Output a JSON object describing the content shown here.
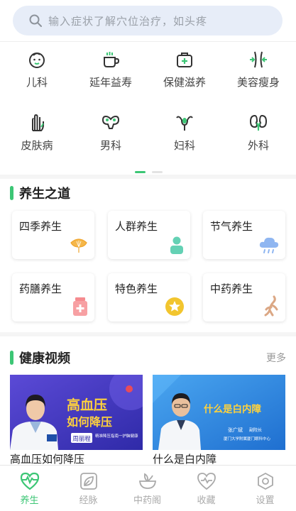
{
  "search": {
    "placeholder": "输入症状了解穴位治疗，如头疼"
  },
  "categories": [
    {
      "label": "儿科",
      "icon": "child-face-icon"
    },
    {
      "label": "延年益寿",
      "icon": "teacup-icon"
    },
    {
      "label": "保健滋养",
      "icon": "first-aid-kit-icon"
    },
    {
      "label": "美容瘦身",
      "icon": "waist-slim-icon"
    },
    {
      "label": "皮肤病",
      "icon": "hand-skin-icon"
    },
    {
      "label": "男科",
      "icon": "male-organ-icon"
    },
    {
      "label": "妇科",
      "icon": "uterus-icon"
    },
    {
      "label": "外科",
      "icon": "kidney-icon"
    }
  ],
  "pager": {
    "pages": 2,
    "current": 1
  },
  "wellness": {
    "title": "养生之道",
    "cards": [
      {
        "label": "四季养生",
        "icon": "ginkgo-leaf-icon"
      },
      {
        "label": "人群养生",
        "icon": "person-icon"
      },
      {
        "label": "节气养生",
        "icon": "rain-cloud-icon"
      },
      {
        "label": "药膳养生",
        "icon": "medicine-bottle-icon"
      },
      {
        "label": "特色养生",
        "icon": "star-badge-icon"
      },
      {
        "label": "中药养生",
        "icon": "ginseng-root-icon"
      }
    ]
  },
  "videos": {
    "title": "健康视频",
    "more": "更多",
    "items": [
      {
        "title": "高血压如何降压",
        "thumb_title_1": "高血压",
        "thumb_title_2": "如何降压",
        "doctor": "周丽程",
        "caption": "精准降压指南一护脑健康"
      },
      {
        "title": "什么是白内障",
        "thumb_title": "什么是白内障",
        "doctor": "张广斌",
        "doctor_role": "副院长",
        "caption": "厦门大学附属厦门眼科中心"
      }
    ]
  },
  "tabs": [
    {
      "label": "养生",
      "icon": "heart-pulse-icon",
      "active": true
    },
    {
      "label": "经脉",
      "icon": "leaf-icon",
      "active": false
    },
    {
      "label": "中药阁",
      "icon": "herb-bowl-icon",
      "active": false
    },
    {
      "label": "收藏",
      "icon": "heart-icon",
      "active": false
    },
    {
      "label": "设置",
      "icon": "settings-icon",
      "active": false
    }
  ],
  "colors": {
    "accent": "#3cc675",
    "search_bg": "#e7edf8",
    "video1_bg": "#4438c8",
    "video2_bg": "#2f8fe6"
  }
}
